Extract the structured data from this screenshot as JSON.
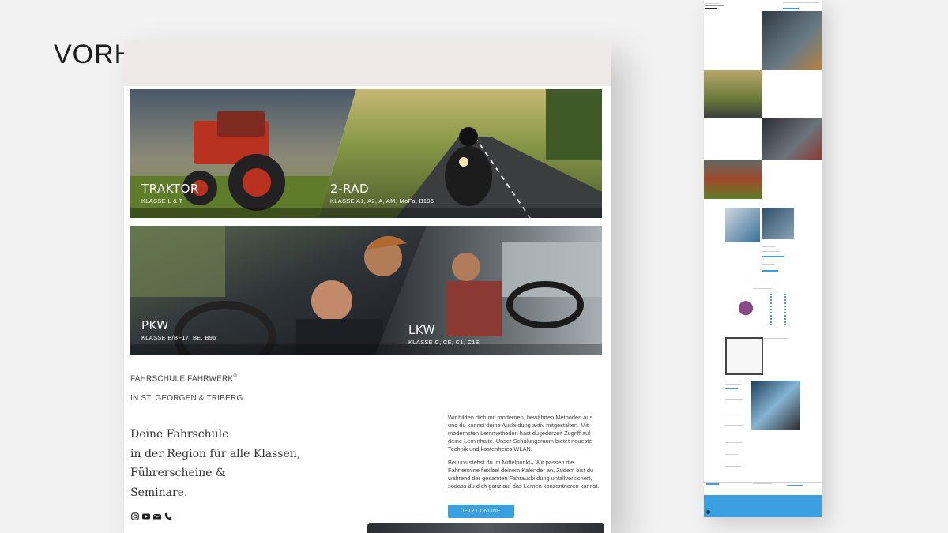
{
  "label": "VORHER",
  "hero": [
    {
      "title": "TRAKTOR",
      "sub": "KLASSE L & T"
    },
    {
      "title": "2-RAD",
      "sub": "KLASSE A1, A2, A, AM, MoFa, B196"
    },
    {
      "title": "PKW",
      "sub": "KLASSE B/BF17, BE, B96"
    },
    {
      "title": "LKW",
      "sub": "KLASSE C, CE, C1, C1E"
    }
  ],
  "brand": {
    "name": "FAHRSCHULE FAHRWERK",
    "reg": "®",
    "location": "IN ST. GEORGEN & TRIBERG"
  },
  "headline": [
    "Deine Fahrschule",
    "in der Region für alle Klassen,",
    "Führerscheine &",
    "Seminare."
  ],
  "socials": [
    "instagram-icon",
    "youtube-icon",
    "mail-icon",
    "phone-icon"
  ],
  "paragraphs": [
    "Wir bilden dich mit modernen, bewährten Methoden aus und du kannst deine Ausbildung aktiv mitgestalten. Mit modernsten Lernmethoden hast du jederzeit Zugriff auf deine Lerninhalte. Unser Schulungsraum bietet neueste Technik und kostenfreies WLAN.",
    "Bei uns stehst du im Mittelpunkt– Wir passen die Fahrtermine flexibel deinem Kalender an. Zudem bist du während der gesamten Fahrausbildung unfallversichert, sodass du dich ganz auf das Lernen konzentrieren kannst."
  ],
  "cta": "JETZT ONLINE ANMELDEN",
  "colors": {
    "accent": "#3aa0e0",
    "header_bg": "#efe9ea"
  }
}
